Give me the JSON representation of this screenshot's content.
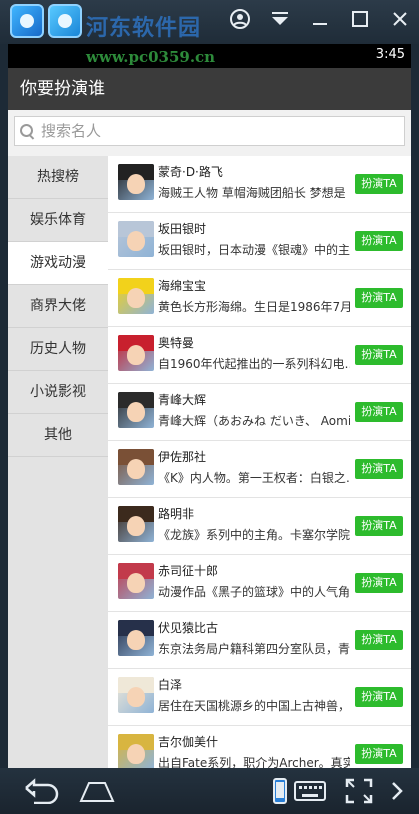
{
  "emulator": {
    "watermark": "河东软件园",
    "watermark_url": "www.pc0359.cn",
    "icons": [
      "user-icon",
      "dropdown-icon",
      "minimize-icon",
      "maximize-icon",
      "close-icon"
    ]
  },
  "status_bar": {
    "time": "3:45"
  },
  "app": {
    "title": "你要扮演谁",
    "search_placeholder": "搜索名人",
    "categories": [
      {
        "label": "热搜榜",
        "active": false
      },
      {
        "label": "娱乐体育",
        "active": false
      },
      {
        "label": "游戏动漫",
        "active": true
      },
      {
        "label": "商界大佬",
        "active": false
      },
      {
        "label": "历史人物",
        "active": false
      },
      {
        "label": "小说影视",
        "active": false
      },
      {
        "label": "其他",
        "active": false
      }
    ],
    "characters": [
      {
        "name": "蒙奇·D·路飞",
        "desc": "海贼王人物 草帽海贼团船长 梦想是",
        "button": "扮演TA"
      },
      {
        "name": "坂田银时",
        "desc": "坂田银时，日本动漫《银魂》中的主…",
        "button": "扮演TA"
      },
      {
        "name": "海绵宝宝",
        "desc": "黄色长方形海绵。生日是1986年7月…",
        "button": "扮演TA"
      },
      {
        "name": "奥特曼",
        "desc": "自1960年代起推出的一系列科幻电…",
        "button": "扮演TA"
      },
      {
        "name": "青峰大辉",
        "desc": "青峰大辉（あおみね だいき、 Aomi…",
        "button": "扮演TA"
      },
      {
        "name": "伊佐那社",
        "desc": "《K》内人物。第一王权者：白银之…",
        "button": "扮演TA"
      },
      {
        "name": "路明非",
        "desc": "《龙族》系列中的主角。卡塞尔学院…",
        "button": "扮演TA"
      },
      {
        "name": "赤司征十郎",
        "desc": "动漫作品《黑子的篮球》中的人气角…",
        "button": "扮演TA"
      },
      {
        "name": "伏见猿比古",
        "desc": "东京法务局户籍科第四分室队员，青…",
        "button": "扮演TA"
      },
      {
        "name": "白泽",
        "desc": "居住在天国桃源乡的中国上古神兽，…",
        "button": "扮演TA"
      },
      {
        "name": "吉尔伽美什",
        "desc": "出自Fate系列，职介为Archer。真实…",
        "button": "扮演TA"
      }
    ]
  },
  "avatar_colors": [
    "#222222",
    "#b8c6d8",
    "#f2d21b",
    "#c8202e",
    "#2b2b2b",
    "#7a5036",
    "#3c2a1d",
    "#c23a4b",
    "#26304a",
    "#efe8d8",
    "#d8b540"
  ],
  "colors": {
    "accent_button": "#2dbb2d",
    "titlebar": "#3b3b3b"
  }
}
